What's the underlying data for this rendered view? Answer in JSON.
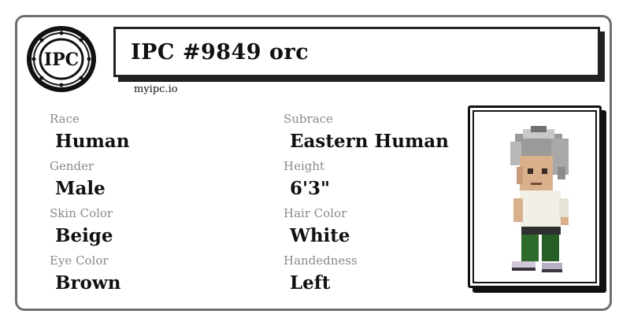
{
  "title": "IPC #9849 orc",
  "site": "myipc.io",
  "logo_text": "IPC",
  "fields": {
    "race": {
      "label": "Race",
      "value": "Human"
    },
    "subrace": {
      "label": "Subrace",
      "value": "Eastern Human"
    },
    "gender": {
      "label": "Gender",
      "value": "Male"
    },
    "height": {
      "label": "Height",
      "value": "6'3\""
    },
    "skin_color": {
      "label": "Skin Color",
      "value": "Beige"
    },
    "hair_color": {
      "label": "Hair Color",
      "value": "White"
    },
    "eye_color": {
      "label": "Eye Color",
      "value": "Brown"
    },
    "handedness": {
      "label": "Handedness",
      "value": "Left"
    }
  },
  "colors": {
    "border": "#6f6f6f",
    "label": "#8a8a8a",
    "text": "#111111"
  },
  "icons": {
    "logo": "ipc-seal-icon",
    "portrait": "character-sprite"
  }
}
